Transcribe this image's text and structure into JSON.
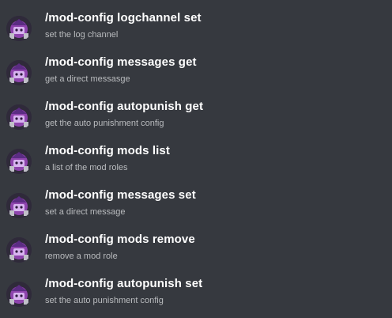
{
  "commands": [
    {
      "name": "/mod-config logchannel set",
      "description": "set the log channel",
      "avatar_icon": "bot-avatar-icon"
    },
    {
      "name": "/mod-config messages get",
      "description": "get a direct messasge",
      "avatar_icon": "bot-avatar-icon"
    },
    {
      "name": "/mod-config autopunish get",
      "description": "get the auto punishment config",
      "avatar_icon": "bot-avatar-icon"
    },
    {
      "name": "/mod-config mods list",
      "description": "a list of the mod roles",
      "avatar_icon": "bot-avatar-icon"
    },
    {
      "name": "/mod-config messages set",
      "description": "set a direct message",
      "avatar_icon": "bot-avatar-icon"
    },
    {
      "name": "/mod-config mods remove",
      "description": "remove a mod role",
      "avatar_icon": "bot-avatar-icon"
    },
    {
      "name": "/mod-config autopunish set",
      "description": "set the auto punishment config",
      "avatar_icon": "bot-avatar-icon"
    }
  ],
  "colors": {
    "background": "#36393f",
    "command_text": "#ffffff",
    "description_text": "#b9bbbe",
    "avatar_accent": "#9b59b6"
  }
}
